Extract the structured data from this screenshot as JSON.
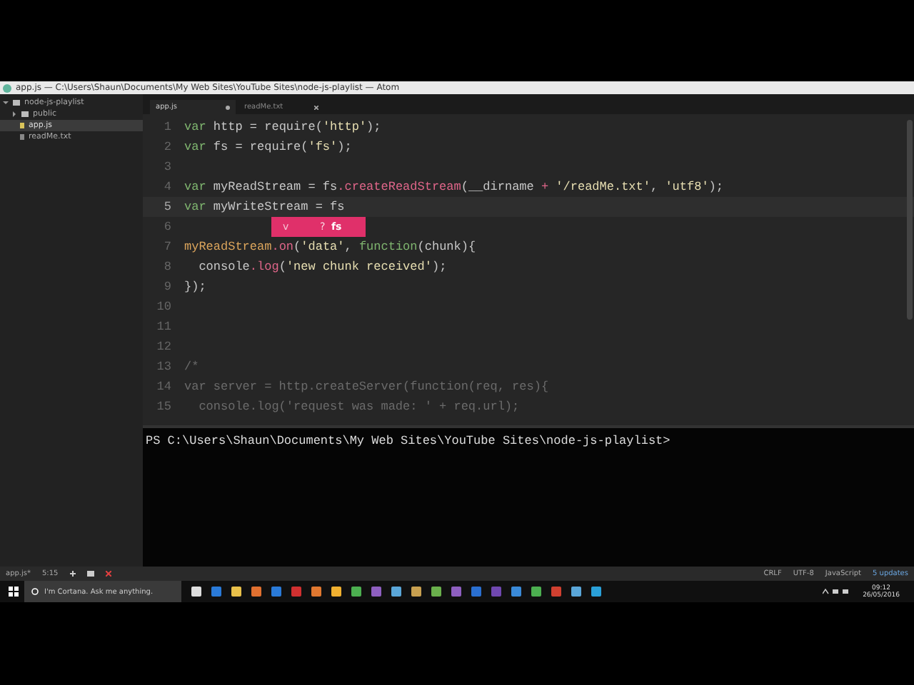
{
  "window": {
    "title": "app.js — C:\\Users\\Shaun\\Documents\\My Web Sites\\YouTube Sites\\node-js-playlist — Atom"
  },
  "tree": {
    "root": {
      "label": "node-js-playlist",
      "kind": "folder",
      "expanded": true,
      "selected": false,
      "children": [
        {
          "label": "public",
          "kind": "folder",
          "expanded": false,
          "selected": false
        },
        {
          "label": "app.js",
          "kind": "file",
          "selected": true
        },
        {
          "label": "readMe.txt",
          "kind": "file",
          "selected": false
        }
      ]
    }
  },
  "tabs": [
    {
      "label": "app.js",
      "selected": true,
      "modified": true
    },
    {
      "label": "readMe.txt",
      "selected": false,
      "modified": false
    }
  ],
  "editor": {
    "lines": [
      {
        "number": "1",
        "current": false,
        "tokens": [
          {
            "text": "var",
            "kind": "keyword"
          },
          {
            "text": " http = require(",
            "kind": "plain"
          },
          {
            "text": "'http'",
            "kind": "string"
          },
          {
            "text": ");",
            "kind": "plain"
          }
        ]
      },
      {
        "number": "2",
        "current": false,
        "tokens": [
          {
            "text": "var",
            "kind": "keyword"
          },
          {
            "text": " fs = require(",
            "kind": "plain"
          },
          {
            "text": "'fs'",
            "kind": "string"
          },
          {
            "text": ");",
            "kind": "plain"
          }
        ]
      },
      {
        "number": "3",
        "current": false
      },
      {
        "number": "4",
        "current": false,
        "tokens": [
          {
            "text": "var",
            "kind": "keyword"
          },
          {
            "text": " myReadStream = fs",
            "kind": "plain"
          },
          {
            "text": ".createReadStream",
            "kind": "function"
          },
          {
            "text": "(__dirname ",
            "kind": "plain"
          },
          {
            "text": "+ ",
            "kind": "function"
          },
          {
            "text": "'/readMe.txt'",
            "kind": "string"
          },
          {
            "text": ", ",
            "kind": "plain"
          },
          {
            "text": "'utf8'",
            "kind": "string"
          },
          {
            "text": ");",
            "kind": "plain"
          }
        ]
      },
      {
        "number": "5",
        "current": true,
        "tokens": [
          {
            "text": "var",
            "kind": "keyword"
          },
          {
            "text": " myWriteStream = fs",
            "kind": "plain"
          }
        ]
      },
      {
        "number": "6",
        "current": false
      },
      {
        "number": "7",
        "current": false,
        "tokens": [
          {
            "text": "myReadStream",
            "kind": "variable"
          },
          {
            "text": ".on",
            "kind": "function"
          },
          {
            "text": "(",
            "kind": "plain"
          },
          {
            "text": "'data'",
            "kind": "string"
          },
          {
            "text": ", ",
            "kind": "plain"
          },
          {
            "text": "function",
            "kind": "keyword"
          },
          {
            "text": "(chunk){",
            "kind": "plain"
          }
        ]
      },
      {
        "number": "8",
        "current": false,
        "tokens": [
          {
            "text": "  console",
            "kind": "plain"
          },
          {
            "text": ".log",
            "kind": "function"
          },
          {
            "text": "(",
            "kind": "plain"
          },
          {
            "text": "'new chunk received'",
            "kind": "string"
          },
          {
            "text": ");",
            "kind": "plain"
          }
        ]
      },
      {
        "number": "9",
        "current": false,
        "tokens": [
          {
            "text": "});",
            "kind": "plain"
          }
        ]
      },
      {
        "number": "10",
        "current": false
      },
      {
        "number": "11",
        "current": false
      },
      {
        "number": "12",
        "current": false
      },
      {
        "number": "13",
        "current": false,
        "tokens": [
          {
            "text": "/*",
            "kind": "comment"
          }
        ]
      },
      {
        "number": "14",
        "current": false,
        "tokens": [
          {
            "text": "var server = http.createServer(function(req, res){",
            "kind": "comment"
          }
        ]
      },
      {
        "number": "15",
        "current": false,
        "tokens": [
          {
            "text": "  console.log('request was made: ' + req.url);",
            "kind": "comment"
          }
        ]
      }
    ]
  },
  "autocomplete": {
    "type_glyph": "v",
    "hint": "?",
    "suggestion": "fs"
  },
  "terminal": {
    "prompt": "PS C:\\Users\\Shaun\\Documents\\My Web Sites\\YouTube Sites\\node-js-playlist>"
  },
  "status_bar": {
    "file": "app.js*",
    "position": "5:15",
    "line_ending": "CRLF",
    "encoding": "UTF-8",
    "grammar": "JavaScript",
    "updates": "5 updates"
  },
  "taskbar": {
    "search_placeholder": "I'm Cortana. Ask me anything.",
    "time": "09:12",
    "date": "26/05/2016"
  }
}
